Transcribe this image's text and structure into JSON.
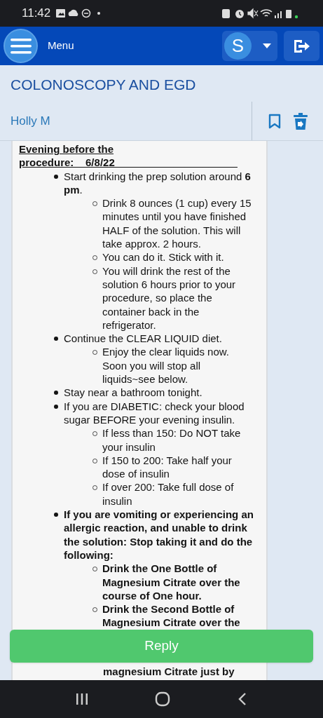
{
  "status_bar": {
    "time": "11:42"
  },
  "header": {
    "menu_label": "Menu",
    "avatar_letter": "S"
  },
  "topic": {
    "title": "COLONOSCOPY AND EGD",
    "author": "Holly M"
  },
  "message": {
    "heading": "Evening before the procedure:__6/8/22_____________________",
    "items": [
      {
        "text": "Start drinking the prep solution around **6 pm**.",
        "children": [
          {
            "text": "Drink 8 ounces (1 cup) every 15 minutes until you have finished HALF of the solution.  This will take approx. 2 hours."
          },
          {
            "text": "You can do it.  Stick with it."
          },
          {
            "text": "You will drink the rest of the solution 6 hours prior to your procedure, so place the container back in the refrigerator."
          }
        ]
      },
      {
        "text": "Continue the CLEAR LIQUID diet.",
        "children": [
          {
            "text": "Enjoy the clear liquids now.  Soon you will stop all liquids~see below."
          }
        ]
      },
      {
        "text": "Stay near a bathroom tonight."
      },
      {
        "text": "If you are DIABETIC:  check your blood sugar BEFORE your evening insulin.",
        "children": [
          {
            "text": "If less than 150:  Do NOT take your insulin"
          },
          {
            "text": "If 150 to 200:  Take half your dose of insulin"
          },
          {
            "text": "If over 200:  Take full dose of insulin"
          }
        ]
      },
      {
        "text": "**If you are vomiting or experiencing an allergic reaction, and unable to drink the solution:  Stop taking it and do the following:**",
        "children": [
          {
            "text": "**Drink the One Bottle of Magnesium Citrate over the course of One hour.**"
          },
          {
            "text": "**Drink the Second Bottle of Magnesium Citrate over the**"
          }
        ]
      }
    ],
    "continued_text": "**magnesium Citrate just by**"
  },
  "reply_button": "Reply"
}
